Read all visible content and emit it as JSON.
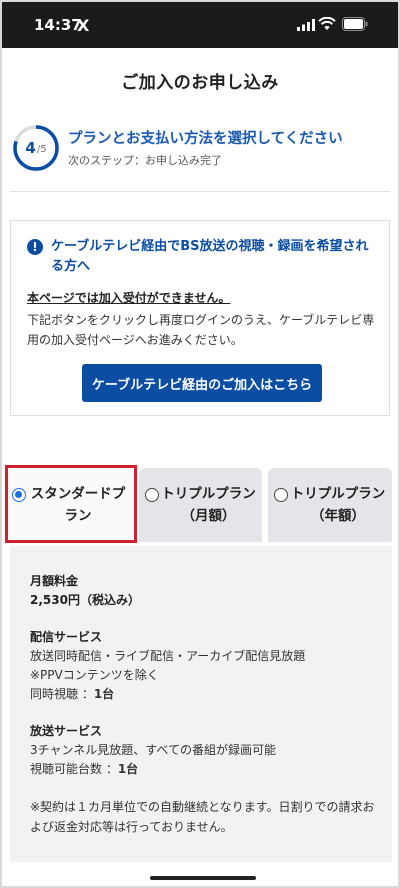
{
  "status_bar": {
    "time": "14:37",
    "app_logo": "X"
  },
  "header": {
    "title": "ご加入のお申し込み"
  },
  "step": {
    "current": "4",
    "total": "/5",
    "progress": 0.8,
    "title": "プランとお支払い方法を選択してください",
    "next": "次のステップ：お申し込み完了"
  },
  "notice": {
    "icon": "!",
    "title": "ケーブルテレビ経由でBS放送の視聴・録画を希望される方へ",
    "subtitle": "本ページでは加入受付ができません。",
    "description": "下記ボタンをクリックし再度ログインのうえ、ケーブルテレビ専用の加入受付ページへお進みください。",
    "button_label": "ケーブルテレビ経由のご加入はこちら"
  },
  "plans": [
    {
      "label_line1": "スタンダードプ",
      "label_line2": "ラン",
      "selected": true
    },
    {
      "label_line1": "トリプルプラン",
      "label_line2": "（月額）",
      "selected": false
    },
    {
      "label_line1": "トリプルプラン",
      "label_line2": "（年額）",
      "selected": false
    }
  ],
  "detail": {
    "fee_heading": "月額料金",
    "fee_value": "2,530円（税込み）",
    "streaming_heading": "配信サービス",
    "streaming_line1": "放送同時配信・ライブ配信・アーカイブ配信見放題",
    "streaming_line2": "※PPVコンテンツを除く",
    "streaming_line3_label": "同時視聴 ：",
    "streaming_line3_value": "1台",
    "broadcast_heading": "放送サービス",
    "broadcast_line1": "3チャンネル見放題、すべての番組が録画可能",
    "broadcast_line2_label": "視聴可能台数 ：",
    "broadcast_line2_value": "1台",
    "note": "※契約は１カ月単位での自動継続となります。日割りでの請求および返金対応等は行っておりません。"
  },
  "colors": {
    "primary": "#0a4da2",
    "highlight": "#d0222c",
    "radio": "#1a6ee0"
  }
}
